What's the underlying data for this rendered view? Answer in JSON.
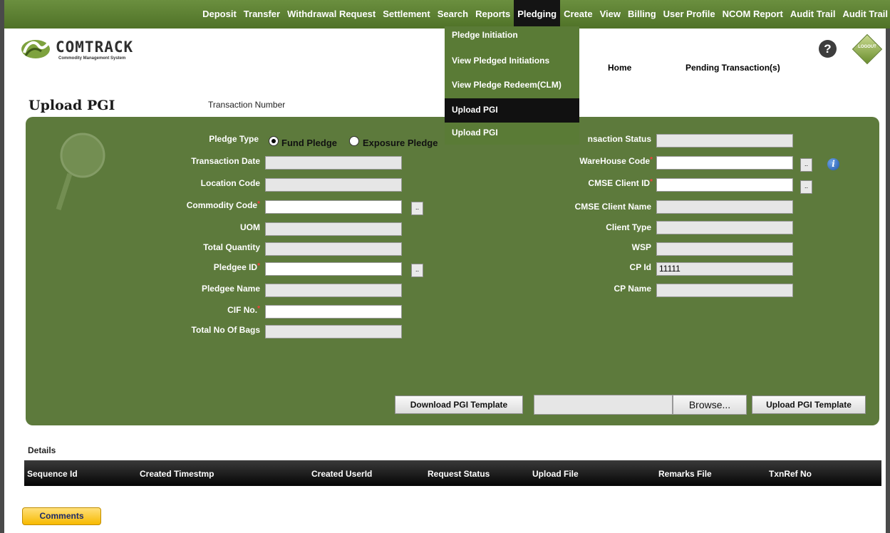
{
  "nav": {
    "items": [
      "Deposit",
      "Transfer",
      "Withdrawal Request",
      "Settlement",
      "Search",
      "Reports",
      "Pledging",
      "Create",
      "View",
      "Billing",
      "User Profile",
      "NCOM Report",
      "Audit Trail",
      "Audit Trail"
    ],
    "active_index": 6
  },
  "pledging_menu": {
    "items": [
      "Pledge Initiation",
      "View Pledged Initiations",
      "View Pledge Redeem(CLM)",
      "Upload PGI",
      "Upload PGI"
    ],
    "highlighted_index": 3
  },
  "header": {
    "brand": "COMTRACK",
    "tagline": "Commodity Management System",
    "home": "Home",
    "pending": "Pending Transaction(s)",
    "help_icon": "?",
    "logout": "LOGOUT"
  },
  "page": {
    "title": "Upload PGI",
    "transaction_number_label": "Transaction Number"
  },
  "form": {
    "pledge_type_label": "Pledge Type",
    "pledge_type_options": [
      "Fund Pledge",
      "Exposure Pledge"
    ],
    "pledge_type_selected": "Fund Pledge",
    "left_fields": [
      {
        "label": "Transaction Date",
        "value": "",
        "required": false,
        "editable": false,
        "lookup": false
      },
      {
        "label": "Location Code",
        "value": "",
        "required": false,
        "editable": false,
        "lookup": false
      },
      {
        "label": "Commodity Code",
        "value": "",
        "required": true,
        "editable": true,
        "lookup": true
      },
      {
        "label": "UOM",
        "value": "",
        "required": false,
        "editable": false,
        "lookup": false
      },
      {
        "label": "Total Quantity",
        "value": "",
        "required": false,
        "editable": false,
        "lookup": false
      },
      {
        "label": "Pledgee ID",
        "value": "",
        "required": true,
        "editable": true,
        "lookup": true
      },
      {
        "label": "Pledgee Name",
        "value": "",
        "required": false,
        "editable": false,
        "lookup": false
      },
      {
        "label": "CIF No.",
        "value": "",
        "required": true,
        "editable": true,
        "lookup": false
      },
      {
        "label": "Total No Of Bags",
        "value": "",
        "required": false,
        "editable": false,
        "lookup": false
      }
    ],
    "right_fields": [
      {
        "label": "Transaction Status",
        "label_visible": "nsaction Status",
        "value": "",
        "required": false,
        "editable": false,
        "lookup": false
      },
      {
        "label": "WareHouse Code",
        "value": "",
        "required": true,
        "editable": true,
        "lookup": true
      },
      {
        "label": "CMSE Client ID",
        "value": "",
        "required": true,
        "editable": true,
        "lookup": true
      },
      {
        "label": "CMSE Client Name",
        "value": "",
        "required": false,
        "editable": false,
        "lookup": false
      },
      {
        "label": "Client Type",
        "value": "",
        "required": false,
        "editable": false,
        "lookup": false
      },
      {
        "label": "WSP",
        "value": "",
        "required": false,
        "editable": false,
        "lookup": false
      },
      {
        "label": "CP Id",
        "value": "11111",
        "required": false,
        "editable": false,
        "lookup": false
      },
      {
        "label": "CP Name",
        "value": "",
        "required": false,
        "editable": false,
        "lookup": false
      }
    ],
    "lookup_label": "..",
    "download_button": "Download PGI Template",
    "browse_button": "Browse...",
    "upload_button": "Upload PGI Template"
  },
  "details": {
    "title": "Details",
    "columns": [
      "Sequence Id",
      "Created Timestmp",
      "Created UserId",
      "Request Status",
      "Upload File",
      "Remarks File",
      "TxnRef No"
    ]
  },
  "comments_button": "Comments",
  "colors": {
    "nav_bg": "#5a7c31",
    "panel_bg": "#5d7a3c",
    "dropdown_bg": "#5a7b36",
    "highlight": "#111111",
    "required": "#ff3b3b",
    "comments_btn": "#f7c51f"
  }
}
